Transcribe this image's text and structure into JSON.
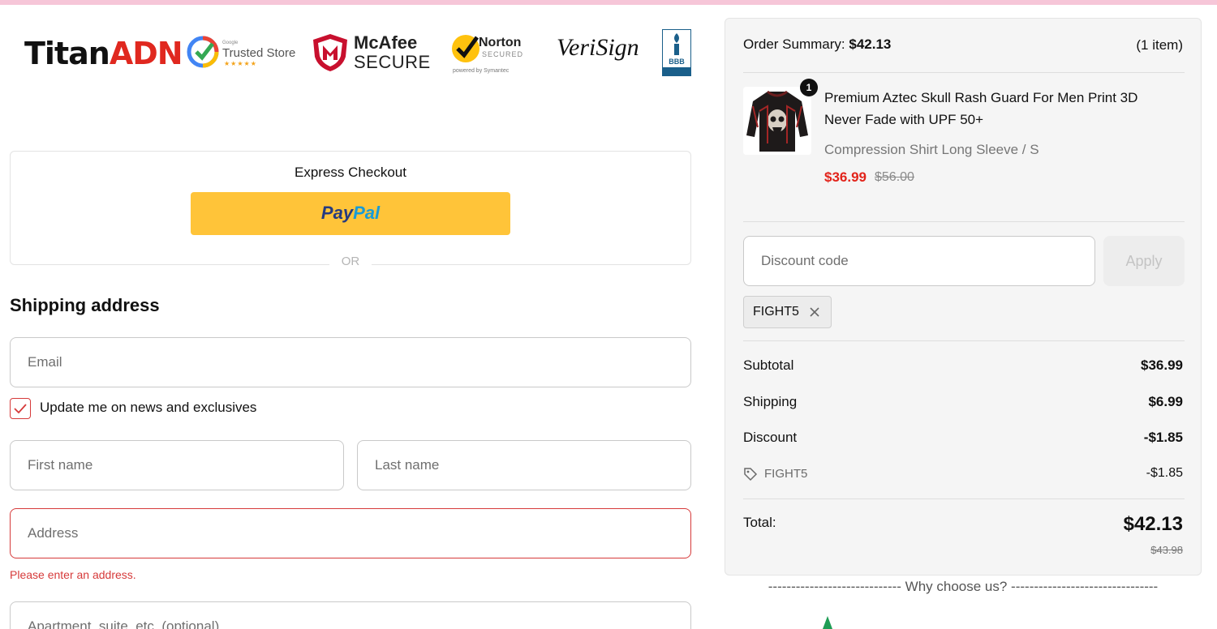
{
  "colors": {
    "accent_error": "#d63a3a",
    "price_red": "#e2231a",
    "paypal_yellow": "#ffc439",
    "top_bar": "#f6c6d8"
  },
  "badges": {
    "brand_part1": "Titan",
    "brand_part2": "ADN",
    "trusted_tiny": "Google",
    "trusted_label": "Trusted Store",
    "trusted_stars": "★★★★★",
    "mcafee_line1": "McAfee",
    "mcafee_line2": "SECURE",
    "norton_line1": "Norton",
    "norton_line2": "SECURED",
    "norton_line3": "powered by Symantec",
    "verisign": "VeriSign",
    "bbb": "BBB"
  },
  "express": {
    "title": "Express Checkout",
    "paypal_part1": "Pay",
    "paypal_part2": "Pal",
    "or": "OR"
  },
  "shipping": {
    "title": "Shipping address",
    "email_placeholder": "Email",
    "newsletter_label": "Update me on news and exclusives",
    "newsletter_checked": true,
    "first_name_placeholder": "First name",
    "last_name_placeholder": "Last name",
    "address_placeholder": "Address",
    "address_error": "Please enter an address.",
    "apartment_placeholder": "Apartment, suite, etc. (optional)"
  },
  "summary": {
    "label": "Order Summary:",
    "total": "$42.13",
    "item_count": "(1 item)",
    "item": {
      "quantity": "1",
      "title": "Premium Aztec Skull Rash Guard For Men Print 3D Never Fade with UPF 50+",
      "variant": "Compression Shirt Long Sleeve / S",
      "price": "$36.99",
      "compare_price": "$56.00"
    },
    "discount_placeholder": "Discount code",
    "apply_label": "Apply",
    "applied_code": "FIGHT5",
    "rows": {
      "subtotal_label": "Subtotal",
      "subtotal_value": "$36.99",
      "shipping_label": "Shipping",
      "shipping_value": "$6.99",
      "discount_label": "Discount",
      "discount_value": "-$1.85",
      "code_label": "FIGHT5",
      "code_value": "-$1.85",
      "total_label": "Total:",
      "total_value": "$42.13",
      "total_compare": "$43.98"
    }
  },
  "why": {
    "text": "----------------------------- Why choose us? --------------------------------"
  }
}
